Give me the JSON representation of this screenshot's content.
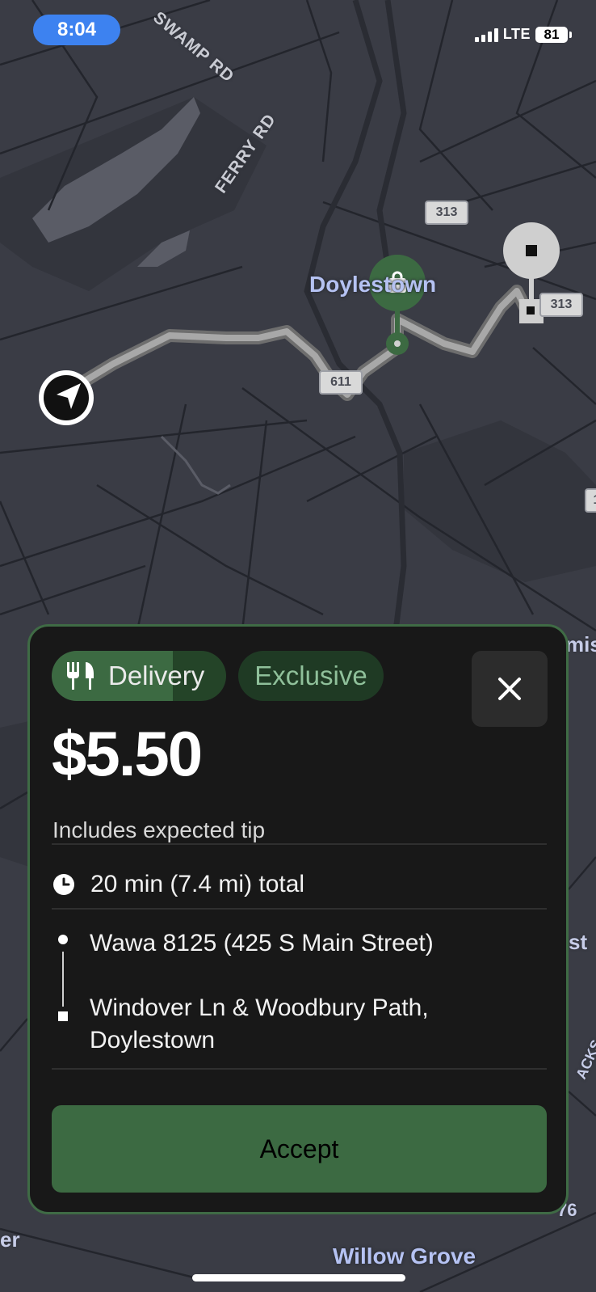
{
  "status_bar": {
    "time": "8:04",
    "network": "LTE",
    "battery": "81"
  },
  "map": {
    "road_labels": [
      "SWAMP RD",
      "FERRY RD"
    ],
    "route_shields": [
      "313",
      "313",
      "611"
    ],
    "town_labels": [
      "Doylestown",
      "Willow Grove"
    ],
    "edge_labels": [
      "mis",
      "st",
      "ACKS",
      "76",
      "er",
      "1"
    ],
    "icons": [
      "navigation-arrow-icon",
      "shopping-bag-icon",
      "square-stop-icon"
    ]
  },
  "offer": {
    "type_label": "Delivery",
    "exclusive_label": "Exclusive",
    "price": "$5.50",
    "price_note": "Includes expected tip",
    "duration": "20 min (7.4 mi) total",
    "pickup": "Wawa 8125 (425 S Main Street)",
    "dropoff_line1": "Windover Ln & Woodbury Path,",
    "dropoff_line2": "Doylestown",
    "accept_label": "Accept"
  },
  "colors": {
    "accent_green": "#3c6a42",
    "card_border": "#3f6b45",
    "map_background": "#3a3c45",
    "route_gray": "#9a9a9a",
    "time_pill_blue": "#3d82f0"
  }
}
